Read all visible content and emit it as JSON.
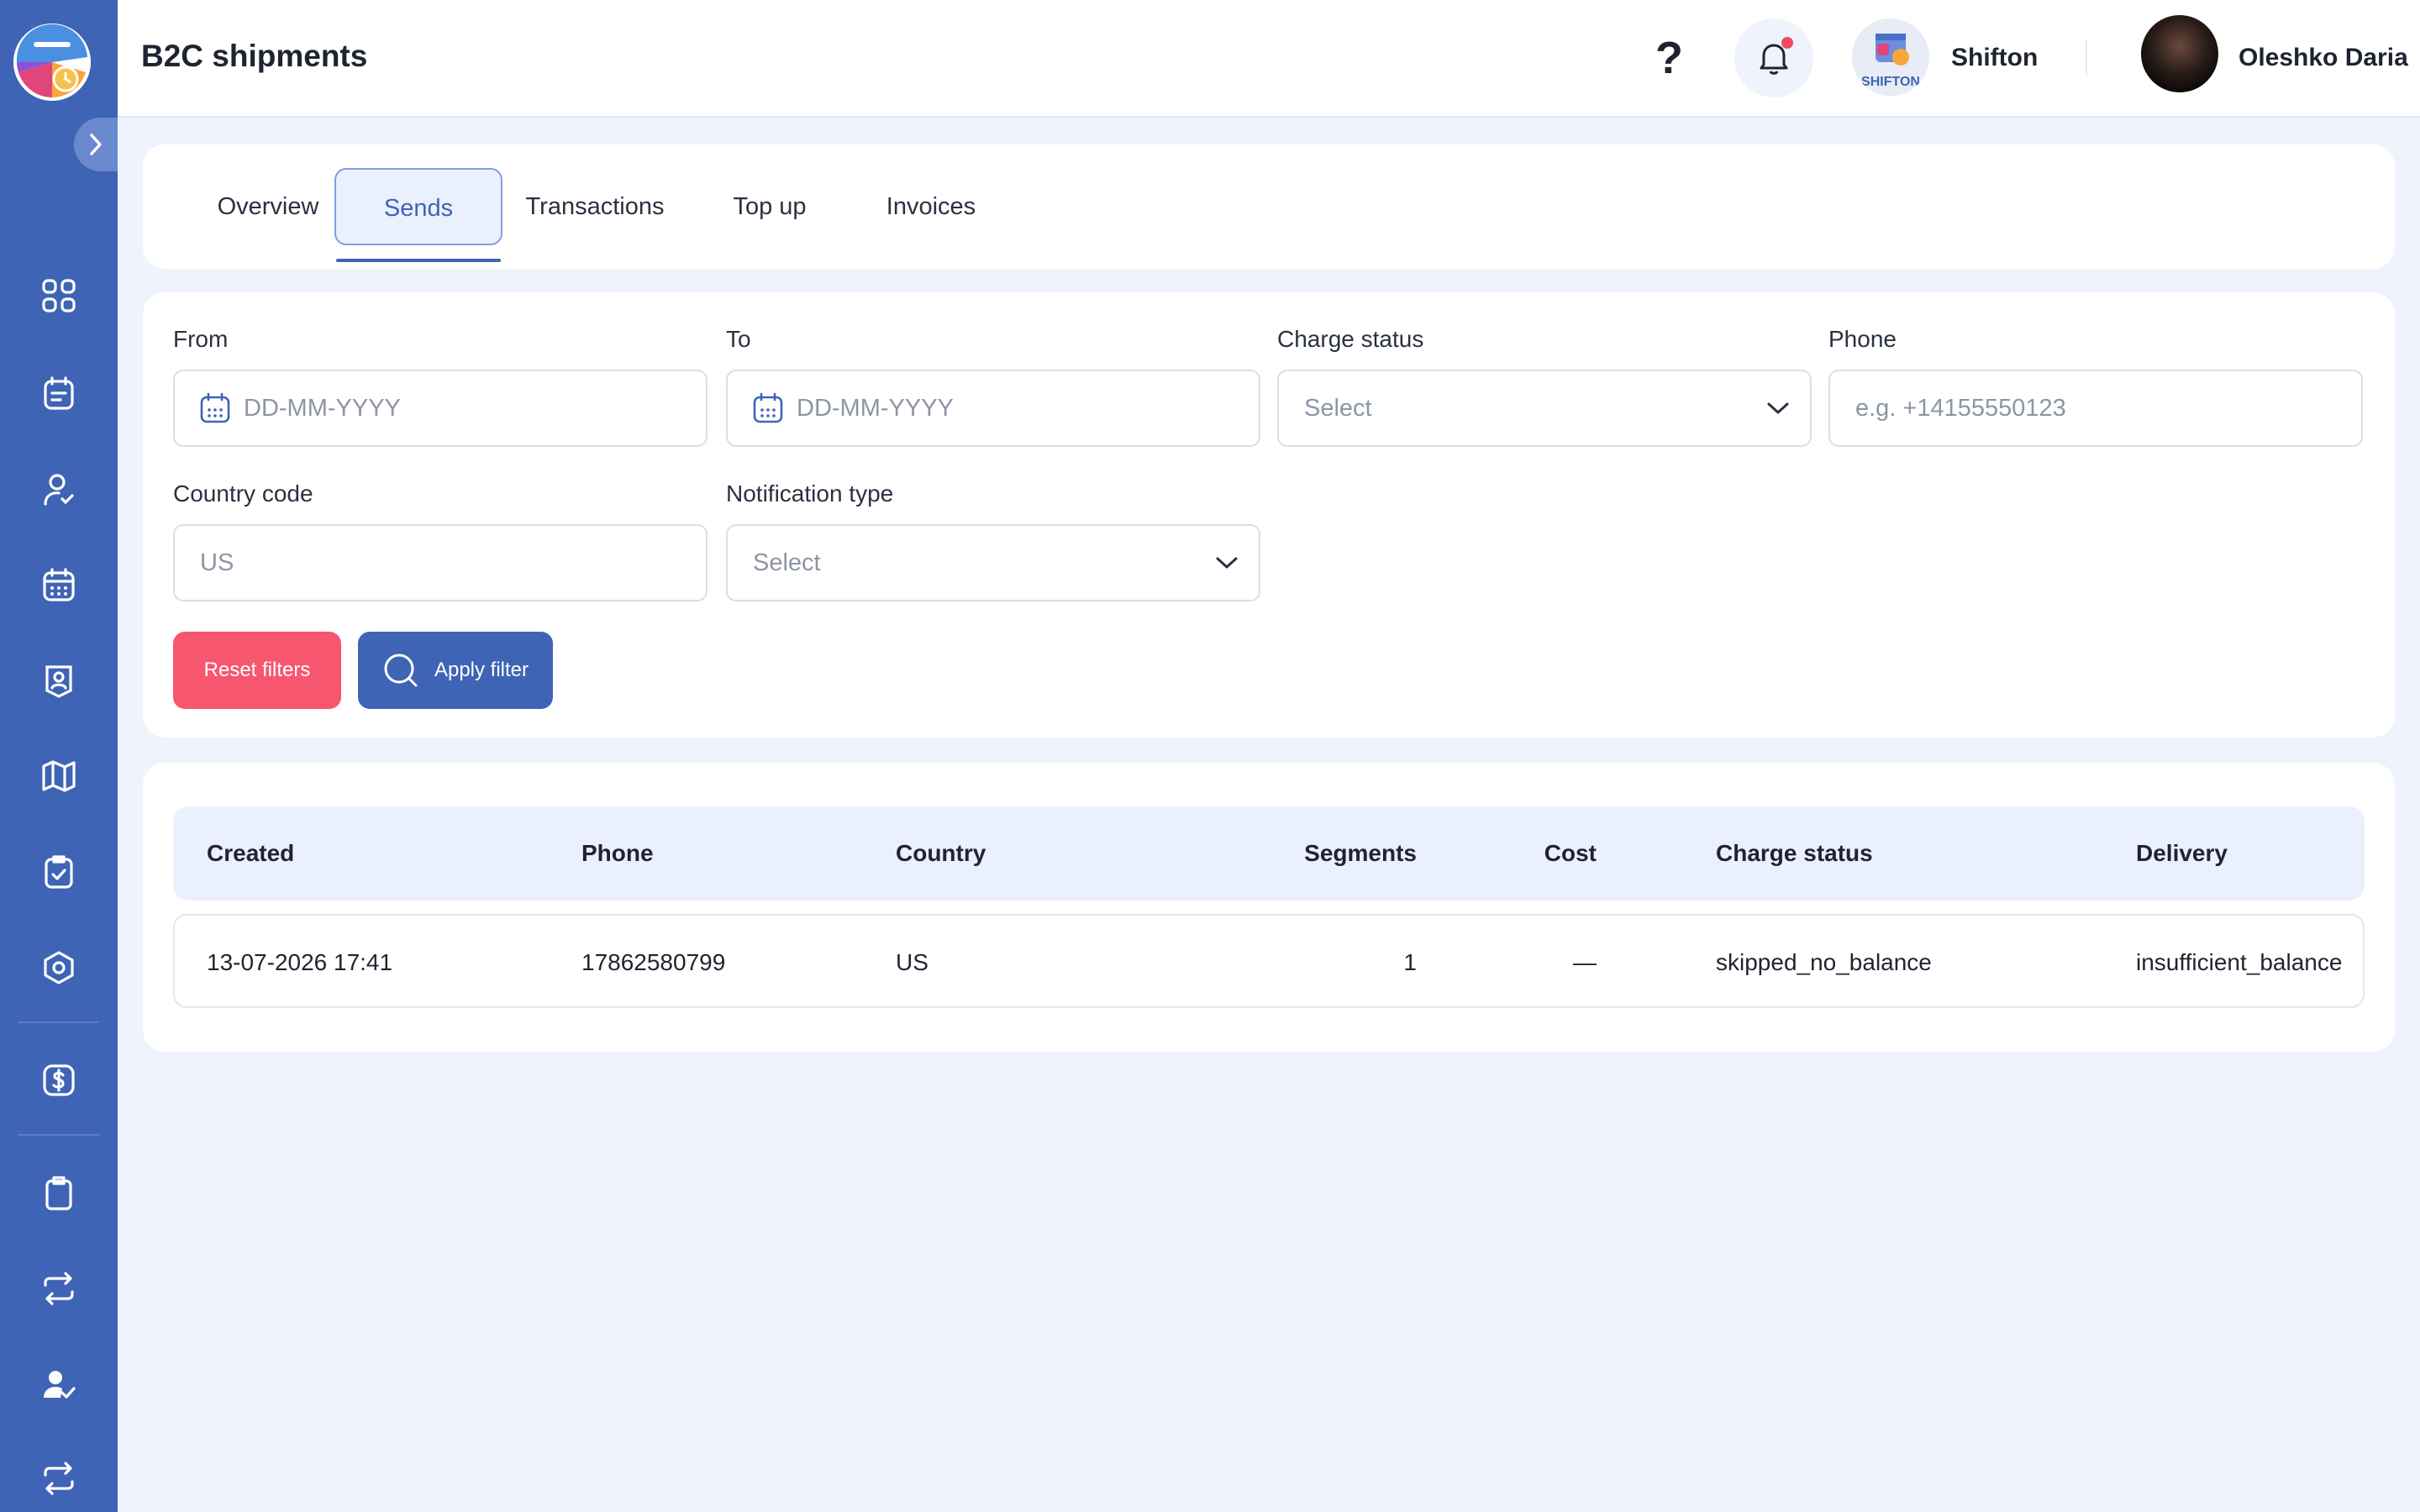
{
  "header": {
    "title": "B2C shipments",
    "help_label": "?",
    "company_name": "Shifton",
    "user_name": "Oleshko Daria"
  },
  "tabs": [
    {
      "label": "Overview",
      "active": false
    },
    {
      "label": "Sends",
      "active": true
    },
    {
      "label": "Transactions",
      "active": false
    },
    {
      "label": "Top up",
      "active": false
    },
    {
      "label": "Invoices",
      "active": false
    }
  ],
  "filters": {
    "from": {
      "label": "From",
      "placeholder": "DD-MM-YYYY"
    },
    "to": {
      "label": "To",
      "placeholder": "DD-MM-YYYY"
    },
    "charge_status": {
      "label": "Charge status",
      "placeholder": "Select"
    },
    "phone": {
      "label": "Phone",
      "placeholder": "e.g. +14155550123"
    },
    "country_code": {
      "label": "Country code",
      "placeholder": "US"
    },
    "notification_type": {
      "label": "Notification type",
      "placeholder": "Select"
    },
    "reset_label": "Reset filters",
    "apply_label": "Apply filter"
  },
  "table": {
    "columns": [
      "Created",
      "Phone",
      "Country",
      "Segments",
      "Cost",
      "Charge status",
      "Delivery"
    ],
    "rows": [
      {
        "created": "13-07-2026 17:41",
        "phone": "17862580799",
        "country": "US",
        "segments": "1",
        "cost": "—",
        "charge_status": "skipped_no_balance",
        "delivery": "insufficient_balance"
      }
    ]
  },
  "colors": {
    "sidebar": "#3f64b5",
    "accent": "#3f64b5",
    "reset": "#f7566f",
    "notification_dot": "#f04a5f",
    "background": "#eef3fc"
  },
  "sidebar_icons": [
    "dashboard-icon",
    "schedule-icon",
    "employee-icon",
    "calendar-icon",
    "badge-icon",
    "map-icon",
    "tasks-icon",
    "settings-icon",
    "billing-icon",
    "clipboard-icon",
    "exchange-icon",
    "user-check-icon",
    "swap-icon"
  ]
}
